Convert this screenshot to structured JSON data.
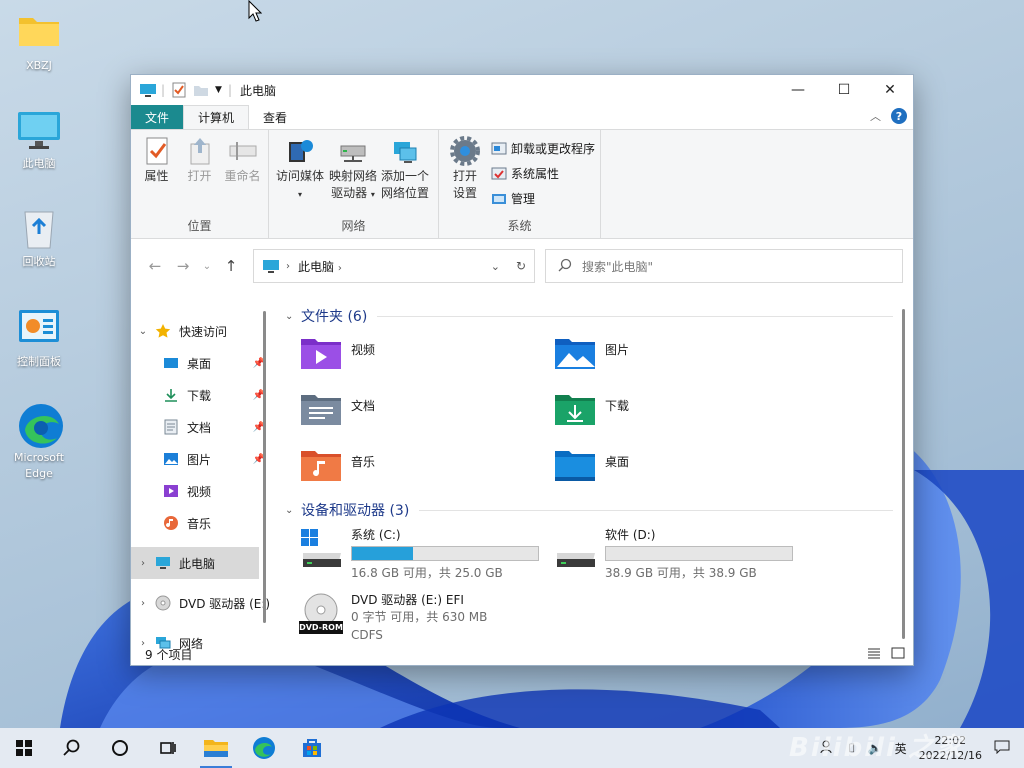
{
  "desktop": {
    "icons": [
      {
        "label": "XBZJ"
      },
      {
        "label": "此电脑"
      },
      {
        "label": "回收站"
      },
      {
        "label": "控制面板"
      },
      {
        "label": "Microsoft Edge"
      }
    ]
  },
  "window": {
    "title": "此电脑",
    "tabs": {
      "file": "文件",
      "computer": "计算机",
      "view": "查看"
    },
    "ribbon": {
      "location": {
        "label": "位置",
        "properties": "属性",
        "open": "打开",
        "rename": "重命名"
      },
      "network": {
        "label": "网络",
        "access_media": "访问媒体",
        "map_drive_1": "映射网络",
        "map_drive_2": "驱动器",
        "add_location_1": "添加一个",
        "add_location_2": "网络位置"
      },
      "system": {
        "label": "系统",
        "open_settings_1": "打开",
        "open_settings_2": "设置",
        "uninstall": "卸载或更改程序",
        "sys_props": "系统属性",
        "manage": "管理"
      }
    },
    "address": {
      "crumb": "此电脑",
      "search_placeholder": "搜索\"此电脑\""
    },
    "nav": {
      "quick_access": "快速访问",
      "items": [
        {
          "label": "桌面",
          "pinned": true
        },
        {
          "label": "下载",
          "pinned": true
        },
        {
          "label": "文档",
          "pinned": true
        },
        {
          "label": "图片",
          "pinned": true
        },
        {
          "label": "视频",
          "pinned": false
        },
        {
          "label": "音乐",
          "pinned": false
        }
      ],
      "this_pc": "此电脑",
      "dvd": "DVD 驱动器 (E:)",
      "network": "网络"
    },
    "folders_header": "文件夹 (6)",
    "folders": [
      {
        "name": "视频"
      },
      {
        "name": "图片"
      },
      {
        "name": "文档"
      },
      {
        "name": "下载"
      },
      {
        "name": "音乐"
      },
      {
        "name": "桌面"
      }
    ],
    "devices_header": "设备和驱动器 (3)",
    "drives": [
      {
        "name": "系统 (C:)",
        "used_fraction": 0.33,
        "info": "16.8 GB 可用，共 25.0 GB"
      },
      {
        "name": "软件 (D:)",
        "used_fraction": 0.0,
        "info": "38.9 GB 可用，共 38.9 GB"
      },
      {
        "name": "DVD 驱动器 (E:) EFI",
        "info": "0 字节 可用，共 630 MB",
        "fs": "CDFS",
        "badge": "DVD-ROM"
      }
    ],
    "status": "9 个项目"
  },
  "taskbar": {
    "lang": "英",
    "time": "22:02",
    "date": "2022/12/16",
    "watermark": "Bilibili 之家"
  }
}
